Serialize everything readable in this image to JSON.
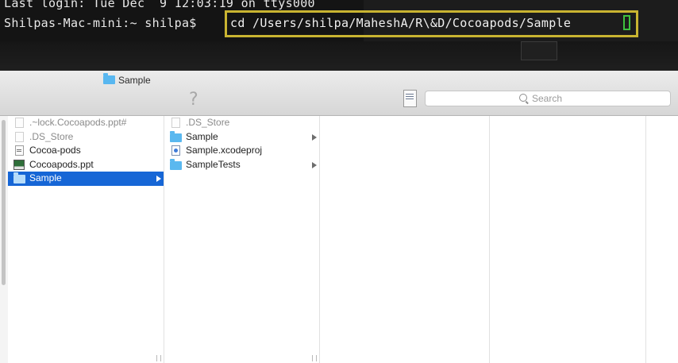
{
  "terminal": {
    "line1": "Last login: Tue Dec  9 12:03:19 on ttys000",
    "prompt": "Shilpas-Mac-mini:~ shilpa$ ",
    "command": "cd /Users/shilpa/MaheshA/R\\&D/Cocoapods/Sample",
    "highlight_color": "#c9b431",
    "cursor_color": "#3ec23e"
  },
  "finder": {
    "title": "Sample",
    "search": {
      "placeholder": "Search",
      "value": ""
    },
    "selection_color": "#1666d6",
    "column1": [
      {
        "label": ".~lock.Cocoapods.ppt#",
        "icon": "blank-document-icon"
      },
      {
        "label": ".DS_Store",
        "icon": "blank-document-icon"
      },
      {
        "label": "Cocoa-pods",
        "icon": "text-document-icon"
      },
      {
        "label": "Cocoapods.ppt",
        "icon": "presentation-icon"
      },
      {
        "label": "Sample",
        "icon": "folder-icon"
      }
    ],
    "column2": [
      {
        "label": ".DS_Store",
        "icon": "blank-document-icon"
      },
      {
        "label": "Sample",
        "icon": "folder-icon"
      },
      {
        "label": "Sample.xcodeproj",
        "icon": "xcode-project-icon"
      },
      {
        "label": "SampleTests",
        "icon": "folder-icon"
      }
    ]
  }
}
